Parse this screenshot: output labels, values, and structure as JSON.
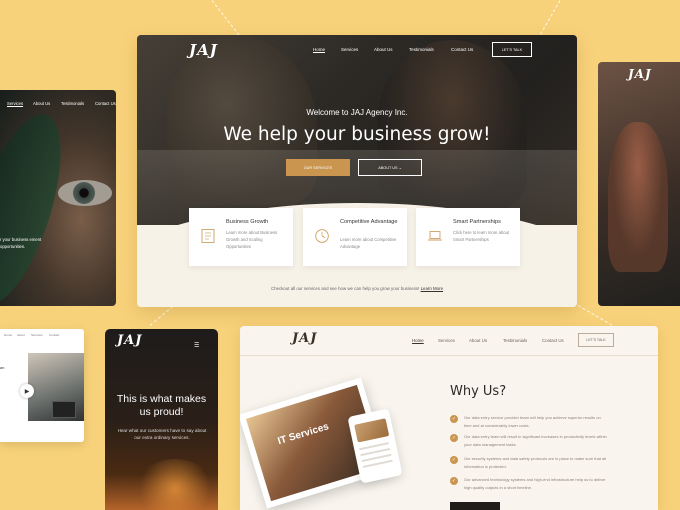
{
  "colors": {
    "background": "#f8d27a",
    "accent": "#c9954f",
    "cream": "#f7f2e8",
    "dark": "#1f1c19"
  },
  "brand": {
    "logo": "JAJ"
  },
  "main_card": {
    "nav": [
      "Home",
      "Services",
      "About Us",
      "Testimonials",
      "Contact Us"
    ],
    "talk_button": "LET'S TALK",
    "kicker": "Welcome to JAJ Agency Inc.",
    "title": "We help your business grow!",
    "btn_services": "OUR SERVICES",
    "btn_about": "ABOUT US  ⌄",
    "features": [
      {
        "icon": "document-icon",
        "title": "Business Growth",
        "desc": "Learn more about Business Growth and Scaling Opportunities"
      },
      {
        "icon": "clock-icon",
        "title": "Competitive Advantage",
        "desc": "Learn more about Competitive Advantage"
      },
      {
        "icon": "laptop-icon",
        "title": "Smart Partnerships",
        "desc": "Click here to learn more about Smart Partnerships"
      }
    ],
    "checkout_text": "Checkout all our services and see how we can help you grow your business!",
    "learn_more": "Learn More"
  },
  "eye_card": {
    "nav": [
      "Services",
      "About Us",
      "Testimonials",
      "Contact Us"
    ],
    "text": "r your business ement opportunities."
  },
  "small_card": {
    "nav": [
      "Home",
      "About",
      "Services",
      "Contact"
    ],
    "text": "an"
  },
  "mobile_card": {
    "menu_icon": "☰",
    "title": "This is what makes us proud!",
    "subtitle": "Hear what our customers have to say about our extra ordinary services."
  },
  "why_card": {
    "nav": [
      "Home",
      "Services",
      "About Us",
      "Testimonials",
      "Contact Us"
    ],
    "talk_button": "LET'S TALK",
    "title": "Why Us?",
    "tile_text": "IT Services",
    "items": [
      "Our data entry service provider team will help you achieve superior results on time and at considerably lower costs.",
      "Our data entry team will result in significant increases in productivity levels within your data management tasks.",
      "Our security systems and data safety protocols are in place to make sure that all information is protected.",
      "Our advanced technology systems and high-end infrastructure help us to deliver high quality outputs in a short timeline."
    ]
  }
}
